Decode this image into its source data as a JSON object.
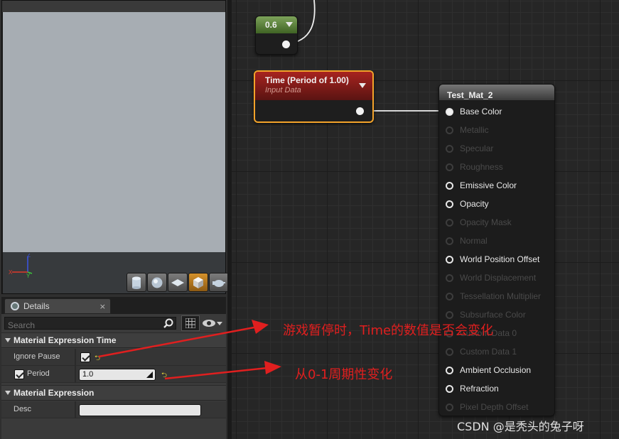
{
  "details": {
    "tab_label": "Details",
    "tab_close": "×",
    "search_placeholder": "Search",
    "sections": [
      {
        "title": "Material Expression Time"
      },
      {
        "title": "Material Expression"
      }
    ],
    "ignore_pause": {
      "label": "Ignore Pause",
      "checked": true
    },
    "period": {
      "label": "Period",
      "value": "1.0",
      "enabled": true
    },
    "desc": {
      "label": "Desc",
      "value": ""
    }
  },
  "nodes": {
    "constant": {
      "value": "0.6"
    },
    "time": {
      "title": "Time (Period of 1.00)",
      "subtitle": "Input Data"
    },
    "material": {
      "title": "Test_Mat_2",
      "pins": [
        {
          "label": "Base Color",
          "state": "connected"
        },
        {
          "label": "Metallic",
          "state": "disabled"
        },
        {
          "label": "Specular",
          "state": "disabled"
        },
        {
          "label": "Roughness",
          "state": "disabled"
        },
        {
          "label": "Emissive Color",
          "state": "enabled"
        },
        {
          "label": "Opacity",
          "state": "enabled"
        },
        {
          "label": "Opacity Mask",
          "state": "disabled"
        },
        {
          "label": "Normal",
          "state": "disabled"
        },
        {
          "label": "World Position Offset",
          "state": "enabled"
        },
        {
          "label": "World Displacement",
          "state": "disabled"
        },
        {
          "label": "Tessellation Multiplier",
          "state": "disabled"
        },
        {
          "label": "Subsurface Color",
          "state": "disabled"
        },
        {
          "label": "Custom Data 0",
          "state": "disabled"
        },
        {
          "label": "Custom Data 1",
          "state": "disabled"
        },
        {
          "label": "Ambient Occlusion",
          "state": "enabled"
        },
        {
          "label": "Refraction",
          "state": "enabled"
        },
        {
          "label": "Pixel Depth Offset",
          "state": "disabled"
        }
      ]
    }
  },
  "annotations": {
    "note_1": "游戏暂停时，Time的数值是否会变化",
    "note_2": "从0-1周期性变化",
    "color": "#e01f1f"
  },
  "watermark": "CSDN @是秃头的兔子呀",
  "colors": {
    "time_node_border": "#f3a32a",
    "time_node_header": "#a8231f",
    "constant_node_header": "#7da35a",
    "viewport_bg": "#a7adb3"
  }
}
